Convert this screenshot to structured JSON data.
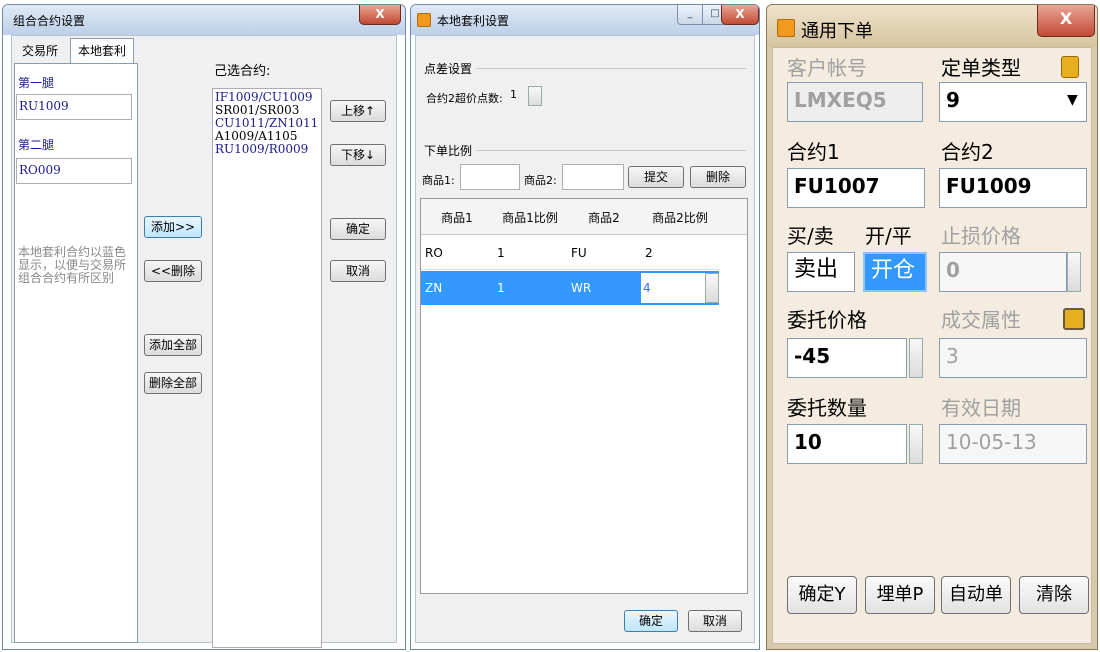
{
  "w1": {
    "title": "组合合约设置",
    "close": "X",
    "tab1": "交易所",
    "tab2": "本地套利",
    "leg1": "第一腿",
    "leg1_value": "RU1009",
    "leg2": "第二腿",
    "leg2_value": "RO009",
    "note": "本地套利合约以蓝色显示，以便与交易所组合合约有所区别",
    "selected_label": "己选合约:",
    "selected": [
      "IF1009/CU1009",
      "SR001/SR003",
      "CU1011/ZN1011",
      "A1009/A1105",
      "RU1009/R0009"
    ],
    "add": "添加>>",
    "del": "<<删除",
    "add_all": "添加全部",
    "del_all": "删除全部",
    "up": "上移↑",
    "down": "下移↓",
    "ok": "确定",
    "cancel": "取消"
  },
  "w2": {
    "title": "本地套利设置",
    "min": "_",
    "max": "□",
    "close": "X",
    "spread_group": "点差设置",
    "spread_label": "合约2超价点数:",
    "spread_value": "1",
    "order_group": "下单比例",
    "p1_label": "商品1:",
    "p2_label": "商品2:",
    "submit": "提交",
    "delete": "删除",
    "headers": [
      "商品1",
      "商品1比例",
      "商品2",
      "商品2比例"
    ],
    "rows": [
      [
        "RO",
        "1",
        "FU",
        "2"
      ],
      [
        "ZN",
        "1",
        "WR",
        "4"
      ]
    ],
    "ok": "确定",
    "cancel": "取消"
  },
  "w3": {
    "title": "通用下单",
    "close": "X",
    "account_label": "客户帐号",
    "account_value": "LMXEQ5",
    "order_type_label": "定单类型",
    "order_type_value": "9",
    "c1_label": "合约1",
    "c1_value": "FU1007",
    "c2_label": "合约2",
    "c2_value": "FU1009",
    "bs_label": "买/卖",
    "oc_label": "开/平",
    "bs_value": "卖出",
    "oc_value": "开仓",
    "stop_label": "止损价格",
    "stop_value": "0",
    "price_label": "委托价格",
    "price_value": "-45",
    "attr_label": "成交属性",
    "attr_value": "3",
    "qty_label": "委托数量",
    "qty_value": "10",
    "date_label": "有效日期",
    "date_value": "10-05-13",
    "b_ok": "确定Y",
    "b_bury": "埋单P",
    "b_auto": "自动单",
    "b_clear": "清除"
  }
}
